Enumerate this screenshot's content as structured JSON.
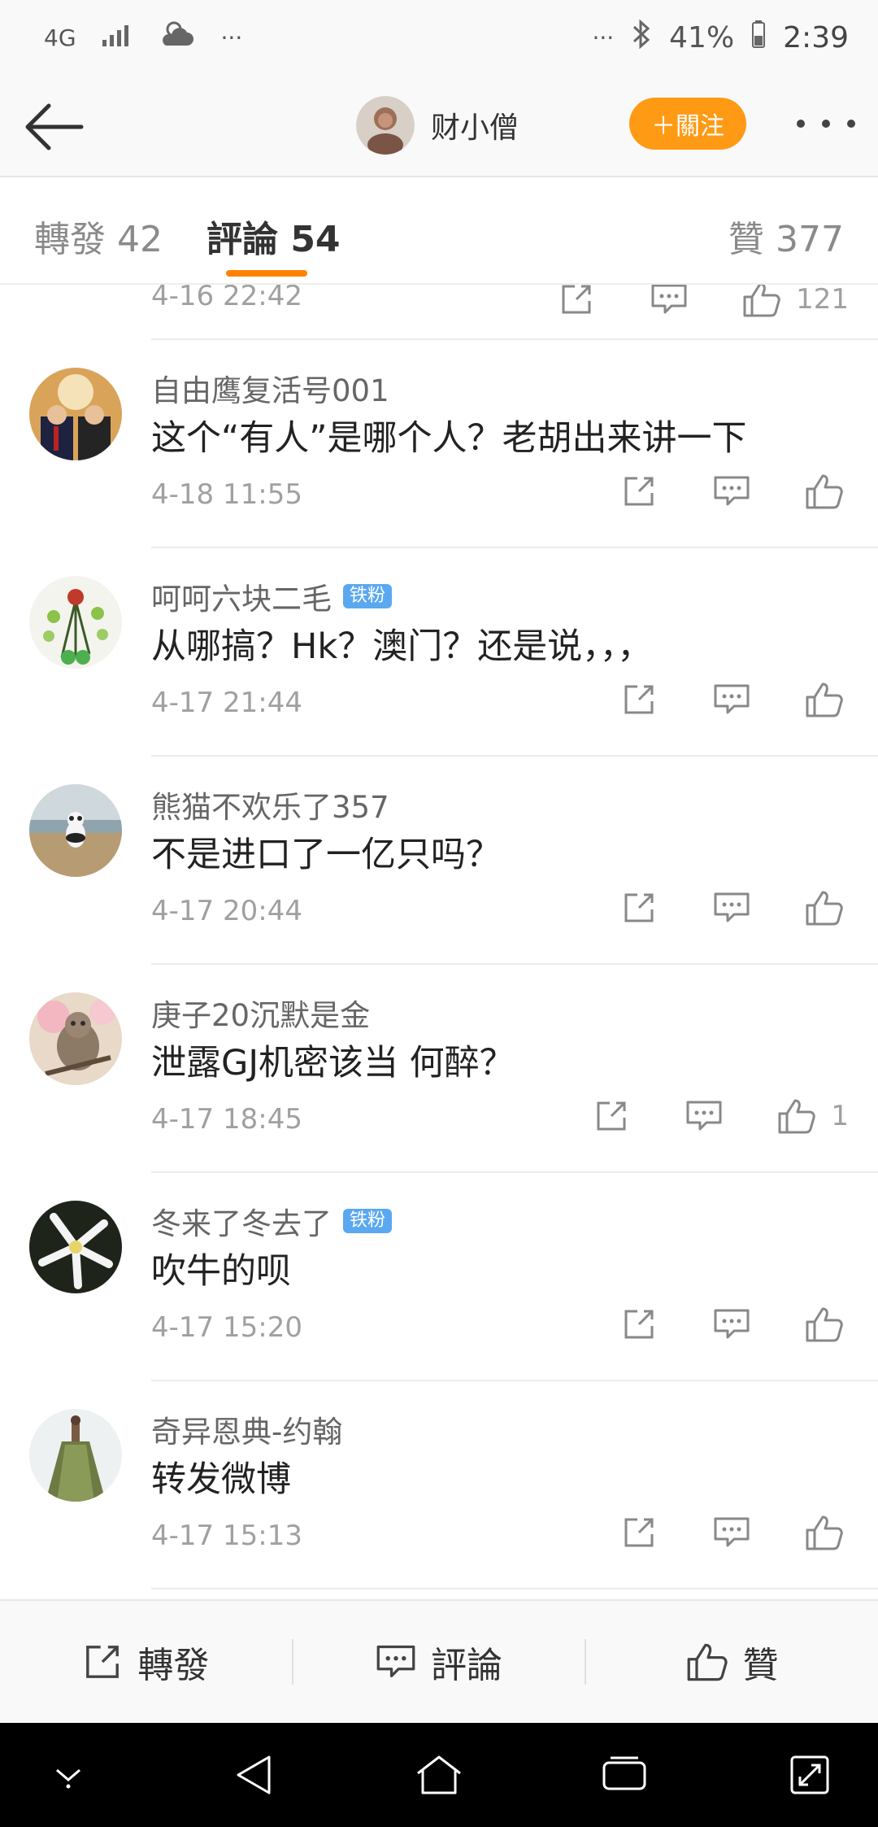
{
  "status_bar": {
    "network": "4G",
    "dots_left": "···",
    "dots_right": "···",
    "battery": "41%",
    "time": "2:39"
  },
  "header": {
    "username": "财小僧",
    "follow_label": "＋關注"
  },
  "tabs": [
    {
      "label": "轉發 42"
    },
    {
      "label": "評論 54"
    },
    {
      "label": "贊 377"
    }
  ],
  "partial_comment": {
    "time": "4-16 22:42",
    "likes": "121"
  },
  "comments": [
    {
      "user": "自由鹰复活号001",
      "badge": "",
      "text": "这个“有人”是哪个人？老胡出来讲一下",
      "time": "4-18 11:55",
      "likes": ""
    },
    {
      "user": "呵呵六块二毛",
      "badge": "铁粉",
      "text": "从哪搞？Hk？澳门？还是说，，，",
      "time": "4-17 21:44",
      "likes": ""
    },
    {
      "user": "熊猫不欢乐了357",
      "badge": "",
      "text": "不是进口了一亿只吗？",
      "time": "4-17 20:44",
      "likes": ""
    },
    {
      "user": "庚子20沉默是金",
      "badge": "",
      "text": "泄露GJ机密该当 何醉？",
      "time": "4-17 18:45",
      "likes": "1"
    },
    {
      "user": "冬来了冬去了",
      "badge": "铁粉",
      "text": "吹牛的呗",
      "time": "4-17 15:20",
      "likes": ""
    },
    {
      "user": "奇异恩典-约翰",
      "badge": "",
      "text": "转发微博",
      "time": "4-17 15:13",
      "likes": ""
    }
  ],
  "bottom_bar": {
    "repost": "轉發",
    "comment": "評論",
    "like": "贊"
  }
}
